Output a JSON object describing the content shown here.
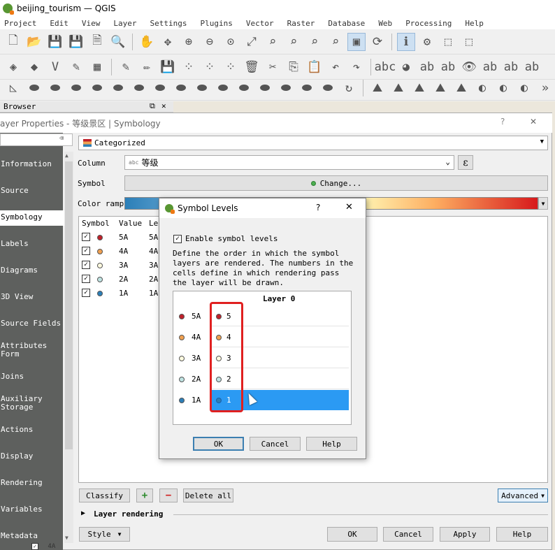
{
  "window": {
    "title": "beijing_tourism — QGIS"
  },
  "menu": [
    "Project",
    "Edit",
    "View",
    "Layer",
    "Settings",
    "Plugins",
    "Vector",
    "Raster",
    "Database",
    "Web",
    "Processing",
    "Help"
  ],
  "browser": {
    "title": "Browser",
    "float_glyph": "⧉",
    "close_glyph": "✕"
  },
  "layer_properties": {
    "title": "ayer Properties - 等级景区 | Symbology",
    "help_glyph": "?",
    "close_glyph": "✕",
    "search_clear": "⌫",
    "tabs": [
      "Information",
      "Source",
      "Symbology",
      "Labels",
      "Diagrams",
      "3D View",
      "Source Fields",
      "Attributes Form",
      "Joins",
      "Auxiliary Storage",
      "Actions",
      "Display",
      "Rendering",
      "Variables",
      "Metadata"
    ],
    "selected_tab": "Symbology",
    "renderer": "Categorized",
    "column_label": "Column",
    "column_type": "abc",
    "column_value": "等级",
    "expr_glyph": "ε",
    "symbol_label": "Symbol",
    "symbol_button": "Change...",
    "color_ramp_label": "Color ramp",
    "table_headers": [
      "Symbol",
      "Value",
      "Le"
    ],
    "categories": [
      {
        "value": "5A",
        "legend": "5A",
        "color": "#c0202a"
      },
      {
        "value": "4A",
        "legend": "4A",
        "color": "#f0a050"
      },
      {
        "value": "3A",
        "legend": "3A",
        "color": "#fffbe0"
      },
      {
        "value": "2A",
        "legend": "2A",
        "color": "#bfe3e2"
      },
      {
        "value": "1A",
        "legend": "1A",
        "color": "#2c7fb8"
      }
    ],
    "classify_button": "Classify",
    "add_glyph": "+",
    "remove_glyph": "−",
    "delete_all_button": "Delete all",
    "advanced_button": "Advanced",
    "layer_rendering": "Layer rendering",
    "style_button": "Style",
    "ok_button": "OK",
    "cancel_button": "Cancel",
    "apply_button": "Apply",
    "help_button": "Help",
    "below_row": "4A"
  },
  "symbol_levels_dialog": {
    "title": "Symbol Levels",
    "help_glyph": "?",
    "close_glyph": "✕",
    "enable_label": "Enable symbol levels",
    "description": "Define the order in which the symbol layers are rendered. The numbers in the cells define in which rendering pass the layer will be drawn.",
    "column_header": "Layer 0",
    "rows": [
      {
        "name": "5A",
        "level": "5",
        "color": "#c0202a"
      },
      {
        "name": "4A",
        "level": "4",
        "color": "#f0a050"
      },
      {
        "name": "3A",
        "level": "3",
        "color": "#fffbe0"
      },
      {
        "name": "2A",
        "level": "2",
        "color": "#bfe3e2"
      },
      {
        "name": "1A",
        "level": "1",
        "color": "#2c7fb8"
      }
    ],
    "selected_row": 4,
    "ok": "OK",
    "cancel": "Cancel",
    "help": "Help"
  },
  "colors": {
    "sidebar": "#5e605e",
    "selection": "#2b9af3",
    "highlight": "#e02020",
    "qgis_green": "#589632"
  }
}
